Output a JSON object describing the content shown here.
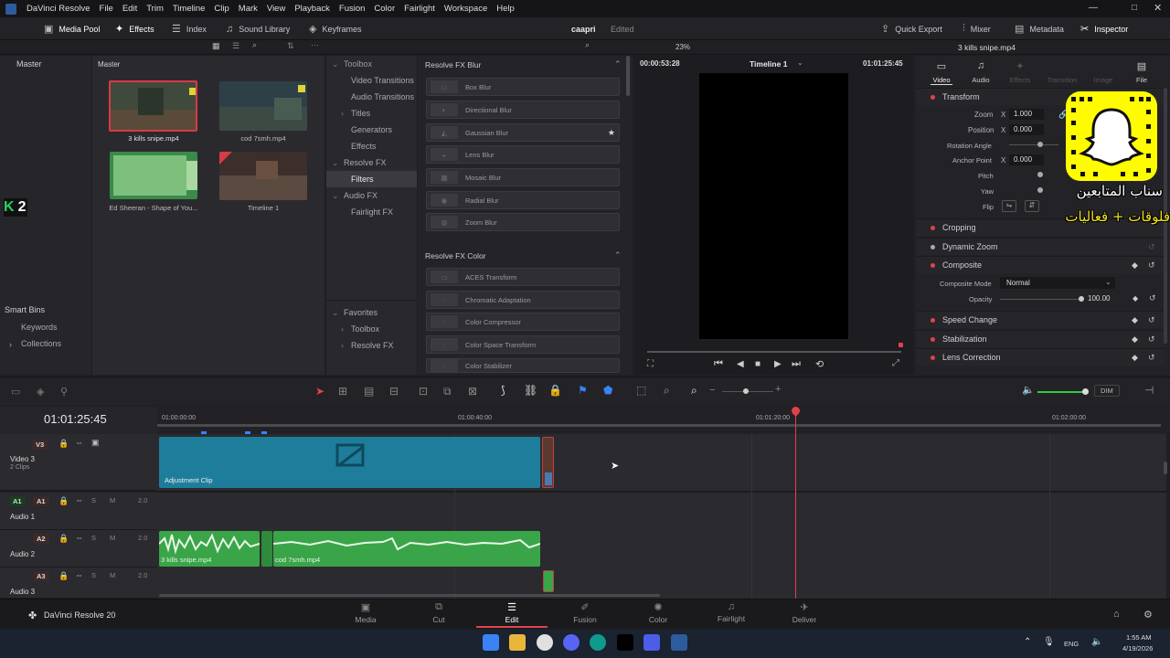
{
  "menubar": {
    "app_title": "DaVinci Resolve",
    "items": [
      "File",
      "Edit",
      "Trim",
      "Timeline",
      "Clip",
      "Mark",
      "View",
      "Playback",
      "Fusion",
      "Color",
      "Fairlight",
      "Workspace",
      "Help"
    ]
  },
  "toolbar": {
    "media_pool": "Media Pool",
    "effects": "Effects",
    "index": "Index",
    "sound_library": "Sound Library",
    "keyframes": "Keyframes",
    "project_name": "caapri",
    "project_status": "Edited",
    "quick_export": "Quick Export",
    "mixer": "Mixer",
    "metadata": "Metadata",
    "inspector": "Inspector"
  },
  "media_pool": {
    "bin_master": "Master",
    "grid_master": "Master",
    "clips": [
      {
        "name": "3 kills snipe.mp4"
      },
      {
        "name": "cod 7smh.mp4"
      },
      {
        "name": "Ed Sheeran - Shape of You..."
      },
      {
        "name": "Timeline 1"
      }
    ],
    "smart_bins": "Smart Bins",
    "keywords": "Keywords",
    "collections": "Collections"
  },
  "overlay_k2": "2",
  "effects_tree": {
    "toolbox": "Toolbox",
    "items": [
      "Video Transitions",
      "Audio Transitions",
      "Titles",
      "Generators",
      "Effects"
    ],
    "resolve_fx": "Resolve FX",
    "filters": "Filters",
    "audio_fx": "Audio FX",
    "fairlight_fx": "Fairlight FX",
    "favorites": "Favorites",
    "fav_toolbox": "Toolbox",
    "fav_resolve_fx": "Resolve FX"
  },
  "fx_list": {
    "blur_header": "Resolve FX Blur",
    "blur_items": [
      "Box Blur",
      "Directional Blur",
      "Gaussian Blur",
      "Lens Blur",
      "Mosaic Blur",
      "Radial Blur",
      "Zoom Blur"
    ],
    "color_header": "Resolve FX Color",
    "color_items": [
      "ACES Transform",
      "Chromatic Adaptation",
      "Color Compressor",
      "Color Space Transform",
      "Color Stabilizer"
    ]
  },
  "viewer": {
    "zoom": "23%",
    "timecode_left": "00:00:53:28",
    "timeline_name": "Timeline 1",
    "timecode_right": "01:01:25:45"
  },
  "inspector": {
    "clip_name": "3 kills snipe.mp4",
    "tabs": [
      "Video",
      "Audio",
      "Effects",
      "Transition",
      "Image",
      "File"
    ],
    "transform": "Transform",
    "zoom_label": "Zoom",
    "zoom_axis": "X",
    "zoom_value": "1.000",
    "position_label": "Position",
    "position_axis": "X",
    "position_value": "0.000",
    "rotation_label": "Rotation Angle",
    "anchor_label": "Anchor Point",
    "anchor_axis": "X",
    "anchor_value": "0.000",
    "pitch_label": "Pitch",
    "yaw_label": "Yaw",
    "flip_label": "Flip",
    "cropping": "Cropping",
    "dynamic_zoom": "Dynamic Zoom",
    "composite": "Composite",
    "composite_mode_label": "Composite Mode",
    "composite_mode_value": "Normal",
    "opacity_label": "Opacity",
    "opacity_value": "100.00",
    "speed_change": "Speed Change",
    "stabilization": "Stabilization",
    "lens_correction": "Lens Correction"
  },
  "snap_overlay": {
    "line1": "سناب المتابعين",
    "line2": "فلوقات + فعاليات"
  },
  "timeline": {
    "current_tc": "01:01:25:45",
    "ruler": [
      "01:00:00:00",
      "01:00:40:00",
      "01:01:20:00",
      "01:02:00:00"
    ],
    "dim": "DIM",
    "v3_badge": "V3",
    "v3_name": "Video 3",
    "v3_clips": "2 Clips",
    "adjustment_clip": "Adjustment Clip",
    "a1_badge": "A1",
    "a1_badge2": "A1",
    "a1_name": "Audio 1",
    "a2_badge": "A2",
    "a2_name": "Audio 2",
    "a3_badge": "A3",
    "a3_name": "Audio 3",
    "ch": "2.0",
    "solo": "S",
    "mute": "M",
    "a2_clip1": "3 kills snipe.mp4",
    "a2_clip2": "cod 7smh.mp4"
  },
  "pages": {
    "brand": "DaVinci Resolve 20",
    "items": [
      "Media",
      "Cut",
      "Edit",
      "Fusion",
      "Color",
      "Fairlight",
      "Deliver"
    ],
    "active": "Edit"
  },
  "taskbar": {
    "lang": "ENG",
    "time": "1:55 AM",
    "date": "4/19/2026"
  }
}
